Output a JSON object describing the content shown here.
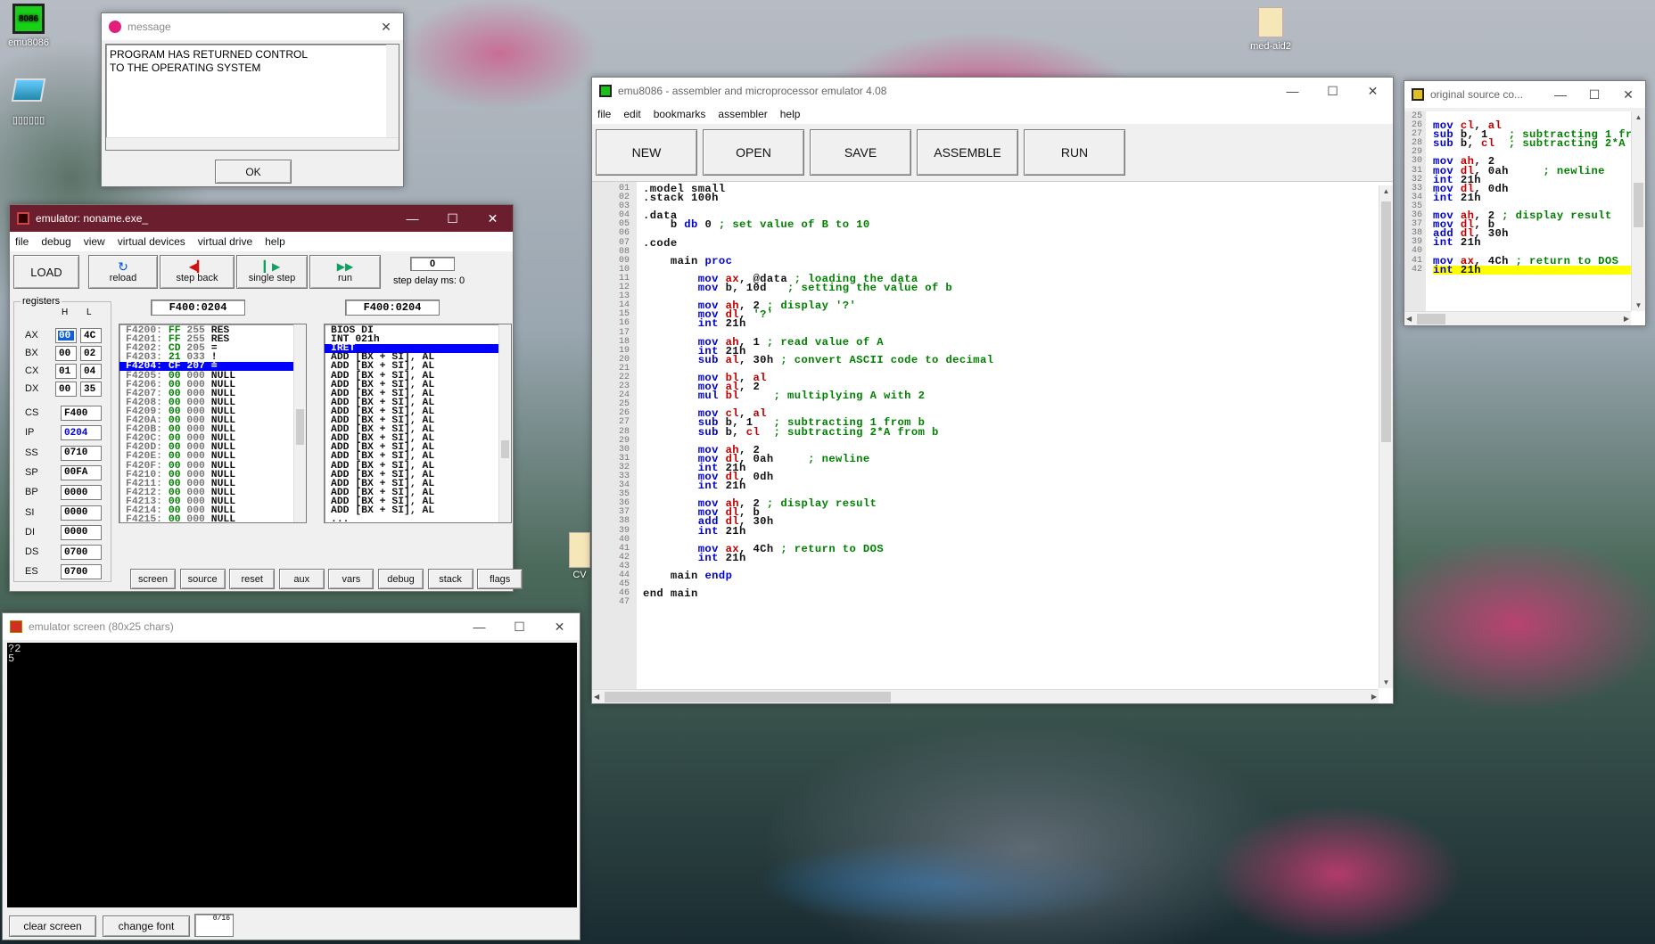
{
  "desktop": {
    "icon_emu": "emu8086",
    "icon_emu_badge": "8086",
    "icon_pc": "▯▯▯▯▯▯",
    "icon_med": "med-aid2",
    "icon_cv": "CV"
  },
  "message": {
    "title": "message",
    "text_line1": "PROGRAM HAS RETURNED CONTROL",
    "text_line2": "TO THE OPERATING SYSTEM",
    "ok": "OK"
  },
  "emulator": {
    "title": "emulator: noname.exe_",
    "menu": [
      "file",
      "debug",
      "view",
      "virtual devices",
      "virtual drive",
      "help"
    ],
    "load": "LOAD",
    "reload": "reload",
    "step_back": "step back",
    "single_step": "single step",
    "run": "run",
    "step_delay_value": "0",
    "step_delay_label": "step delay ms: 0",
    "addr1": "F400:0204",
    "addr2": "F400:0204",
    "registers_label": "registers",
    "h": "H",
    "l": "L",
    "regs": [
      {
        "name": "AX",
        "h": "00",
        "l": "4C"
      },
      {
        "name": "BX",
        "h": "00",
        "l": "02"
      },
      {
        "name": "CX",
        "h": "01",
        "l": "04"
      },
      {
        "name": "DX",
        "h": "00",
        "l": "35"
      }
    ],
    "regs16": [
      {
        "name": "CS",
        "val": "F400"
      },
      {
        "name": "IP",
        "val": "0204"
      },
      {
        "name": "SS",
        "val": "0710"
      },
      {
        "name": "SP",
        "val": "00FA"
      },
      {
        "name": "BP",
        "val": "0000"
      },
      {
        "name": "SI",
        "val": "0000"
      },
      {
        "name": "DI",
        "val": "0000"
      },
      {
        "name": "DS",
        "val": "0700"
      },
      {
        "name": "ES",
        "val": "0700"
      }
    ],
    "memory": [
      [
        "F4200:",
        "FF",
        "255",
        "RES"
      ],
      [
        "F4201:",
        "FF",
        "255",
        "RES"
      ],
      [
        "F4202:",
        "CD",
        "205",
        "="
      ],
      [
        "F4203:",
        "21",
        "033",
        "!"
      ],
      [
        "F4204:",
        "CF",
        "207",
        "≐"
      ],
      [
        "F4205:",
        "00",
        "000",
        "NULL"
      ],
      [
        "F4206:",
        "00",
        "000",
        "NULL"
      ],
      [
        "F4207:",
        "00",
        "000",
        "NULL"
      ],
      [
        "F4208:",
        "00",
        "000",
        "NULL"
      ],
      [
        "F4209:",
        "00",
        "000",
        "NULL"
      ],
      [
        "F420A:",
        "00",
        "000",
        "NULL"
      ],
      [
        "F420B:",
        "00",
        "000",
        "NULL"
      ],
      [
        "F420C:",
        "00",
        "000",
        "NULL"
      ],
      [
        "F420D:",
        "00",
        "000",
        "NULL"
      ],
      [
        "F420E:",
        "00",
        "000",
        "NULL"
      ],
      [
        "F420F:",
        "00",
        "000",
        "NULL"
      ],
      [
        "F4210:",
        "00",
        "000",
        "NULL"
      ],
      [
        "F4211:",
        "00",
        "000",
        "NULL"
      ],
      [
        "F4212:",
        "00",
        "000",
        "NULL"
      ],
      [
        "F4213:",
        "00",
        "000",
        "NULL"
      ],
      [
        "F4214:",
        "00",
        "000",
        "NULL"
      ],
      [
        "F4215:",
        "00",
        "000",
        "NULL"
      ]
    ],
    "disasm": [
      "BIOS DI",
      "INT 021h",
      "IRET",
      "ADD [BX + SI], AL",
      "ADD [BX + SI], AL",
      "ADD [BX + SI], AL",
      "ADD [BX + SI], AL",
      "ADD [BX + SI], AL",
      "ADD [BX + SI], AL",
      "ADD [BX + SI], AL",
      "ADD [BX + SI], AL",
      "ADD [BX + SI], AL",
      "ADD [BX + SI], AL",
      "ADD [BX + SI], AL",
      "ADD [BX + SI], AL",
      "ADD [BX + SI], AL",
      "ADD [BX + SI], AL",
      "ADD [BX + SI], AL",
      "ADD [BX + SI], AL",
      "ADD [BX + SI], AL",
      "ADD [BX + SI], AL",
      "..."
    ],
    "bottom": [
      "screen",
      "source",
      "reset",
      "aux",
      "vars",
      "debug",
      "stack",
      "flags"
    ]
  },
  "screen": {
    "title": "emulator screen (80x25 chars)",
    "line1": "?2",
    "line2": "5",
    "clear": "clear screen",
    "font": "change font",
    "counter": "0/16"
  },
  "editor": {
    "title": "emu8086 - assembler and microprocessor emulator 4.08",
    "menu": [
      "file",
      "edit",
      "bookmarks",
      "assembler",
      "help"
    ],
    "toolbar": [
      "NEW",
      "OPEN",
      "SAVE",
      "ASSEMBLE",
      "RUN"
    ]
  },
  "source": {
    "title": "original source co..."
  },
  "colors": {
    "title_active": "#6b1e2e",
    "selection": "#0000ff",
    "highlight": "#ffff00"
  }
}
